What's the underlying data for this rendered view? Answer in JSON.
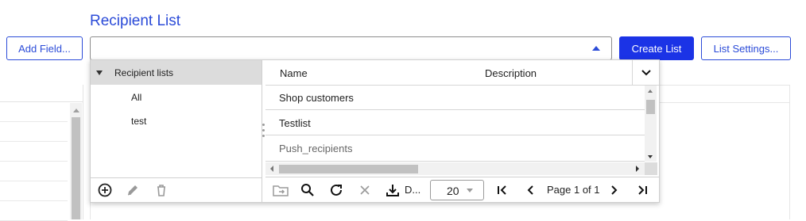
{
  "header": {
    "title": "Recipient List",
    "add_field_label": "Add Field...",
    "create_list_label": "Create List",
    "list_settings_label": "List Settings..."
  },
  "combo": {
    "value": ""
  },
  "tree": {
    "root_label": "Recipient lists",
    "items": [
      "All",
      "test"
    ]
  },
  "grid": {
    "columns": [
      "Name",
      "Description"
    ],
    "rows": [
      {
        "name": "Shop customers",
        "description": ""
      },
      {
        "name": "Testlist",
        "description": ""
      },
      {
        "name": "Push_recipients",
        "description": ""
      }
    ]
  },
  "pager": {
    "download_label": "D...",
    "page_size": "20",
    "page_text": "Page 1 of 1"
  },
  "colors": {
    "accent": "#2b4bd8",
    "primary_button": "#1b33e6",
    "tree_header_bg": "#dcdcdc",
    "icon_gray": "#9a9a9a"
  }
}
